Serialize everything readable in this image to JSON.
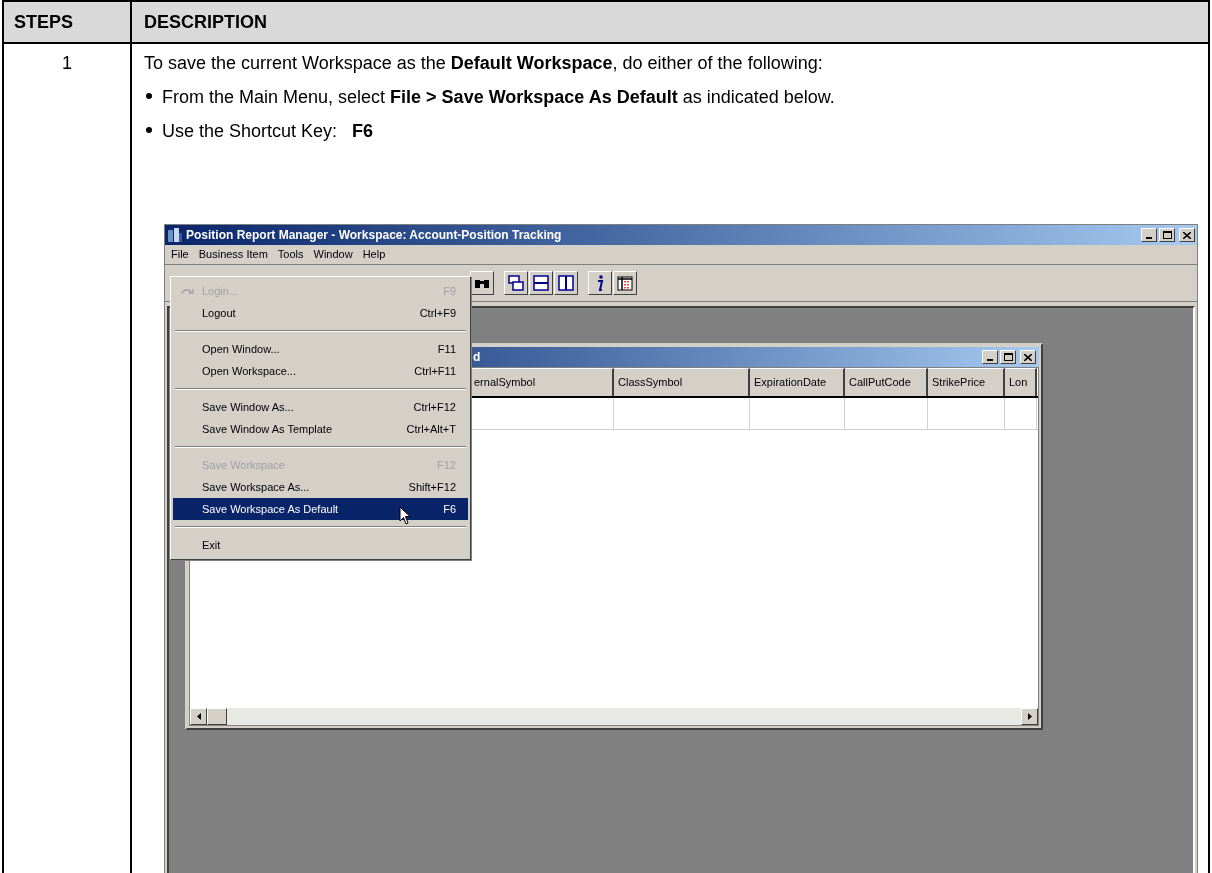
{
  "table": {
    "columns": [
      "STEPS",
      "DESCRIPTION"
    ],
    "rows": [
      {
        "step": "1",
        "intro": "To save the current Workspace as the **Default Workspace**, do either of the following:",
        "bullets": [
          "From the Main Menu, select **File > Save Workspace As Default** as indicated below.",
          "Use the Shortcut Key:   **F6**"
        ],
        "screenshot": {
          "window": {
            "title": "Position Report Manager - Workspace: Account-Position Tracking"
          },
          "menu_bar": [
            "File",
            "Business Item",
            "Tools",
            "Window",
            "Help"
          ],
          "file_menu": [
            {
              "kind": "item",
              "label": "Login...",
              "shortcut": "F9",
              "disabled": true,
              "selected": false
            },
            {
              "kind": "item",
              "label": "Logout",
              "shortcut": "Ctrl+F9",
              "disabled": false,
              "selected": false
            },
            {
              "kind": "separator"
            },
            {
              "kind": "item",
              "label": "Open Window...",
              "shortcut": "F11",
              "disabled": false,
              "selected": false
            },
            {
              "kind": "item",
              "label": "Open Workspace...",
              "shortcut": "Ctrl+F11",
              "disabled": false,
              "selected": false
            },
            {
              "kind": "separator"
            },
            {
              "kind": "item",
              "label": "Save Window As...",
              "shortcut": "Ctrl+F12",
              "disabled": false,
              "selected": false
            },
            {
              "kind": "item",
              "label": "Save Window As Template",
              "shortcut": "Ctrl+Alt+T",
              "disabled": false,
              "selected": false
            },
            {
              "kind": "separator"
            },
            {
              "kind": "item",
              "label": "Save Workspace",
              "shortcut": "F12",
              "disabled": true,
              "selected": false
            },
            {
              "kind": "item",
              "label": "Save Workspace As...",
              "shortcut": "Shift+F12",
              "disabled": false,
              "selected": false
            },
            {
              "kind": "item",
              "label": "Save Workspace As Default",
              "shortcut": "F6",
              "disabled": false,
              "selected": true
            },
            {
              "kind": "separator"
            },
            {
              "kind": "item",
              "label": "Exit",
              "disabled": false,
              "selected": false
            }
          ],
          "child_window": {
            "title": "d",
            "columns": [
              "ernalSymbol",
              "ClassSymbol",
              "ExpirationDate",
              "CallPutCode",
              "StrikePrice",
              "Lon"
            ]
          }
        }
      }
    ]
  }
}
